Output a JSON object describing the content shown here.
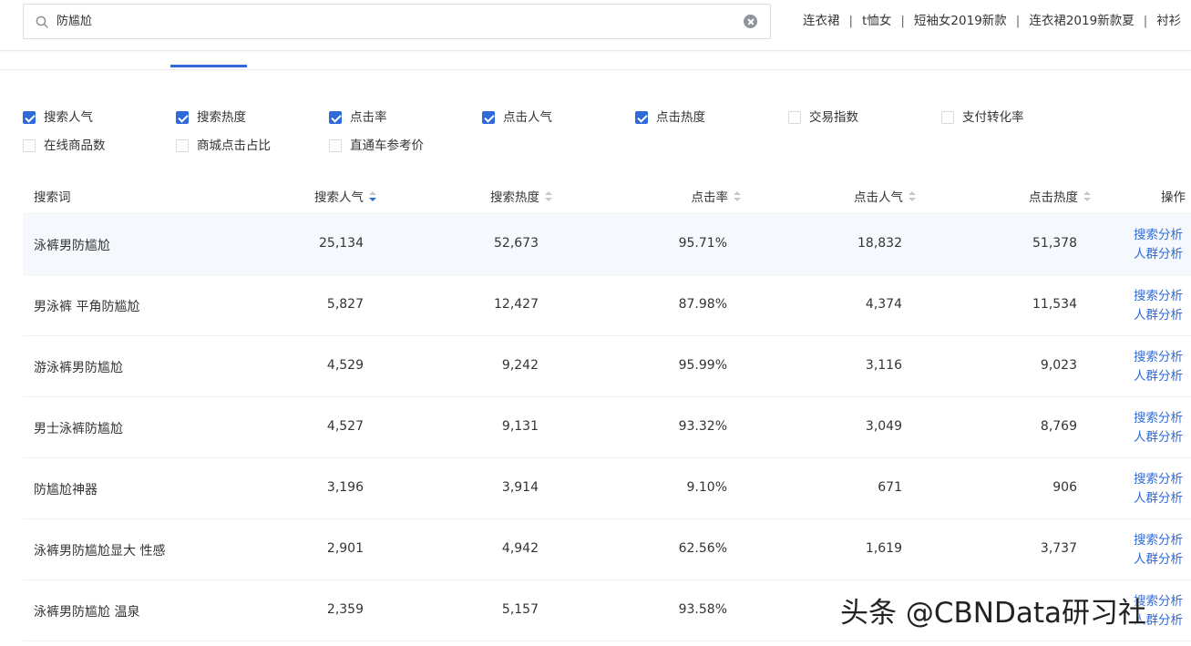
{
  "search": {
    "value": "防尴尬",
    "hot_words": [
      "连衣裙",
      "t恤女",
      "短袖女2019新款",
      "连衣裙2019新款夏",
      "衬衫"
    ],
    "separator": "|"
  },
  "filters": {
    "items": [
      {
        "label": "搜索人气",
        "checked": true
      },
      {
        "label": "搜索热度",
        "checked": true
      },
      {
        "label": "点击率",
        "checked": true
      },
      {
        "label": "点击人气",
        "checked": true
      },
      {
        "label": "点击热度",
        "checked": true
      },
      {
        "label": "交易指数",
        "checked": false
      },
      {
        "label": "支付转化率",
        "checked": false
      },
      {
        "label": "在线商品数",
        "checked": false
      },
      {
        "label": "商城点击占比",
        "checked": false
      },
      {
        "label": "直通车参考价",
        "checked": false
      }
    ]
  },
  "table": {
    "headers": {
      "keyword": "搜索词",
      "search_pop": "搜索人气",
      "search_heat": "搜索热度",
      "ctr": "点击率",
      "click_pop": "点击人气",
      "click_heat": "点击热度",
      "ops": "操作"
    },
    "op_search": "搜索分析",
    "op_crowd": "人群分析",
    "rows": [
      {
        "keyword": "泳裤男防尴尬",
        "search_pop": "25,134",
        "search_heat": "52,673",
        "ctr": "95.71%",
        "click_pop": "18,832",
        "click_heat": "51,378"
      },
      {
        "keyword": "男泳裤 平角防尴尬",
        "search_pop": "5,827",
        "search_heat": "12,427",
        "ctr": "87.98%",
        "click_pop": "4,374",
        "click_heat": "11,534"
      },
      {
        "keyword": "游泳裤男防尴尬",
        "search_pop": "4,529",
        "search_heat": "9,242",
        "ctr": "95.99%",
        "click_pop": "3,116",
        "click_heat": "9,023"
      },
      {
        "keyword": "男士泳裤防尴尬",
        "search_pop": "4,527",
        "search_heat": "9,131",
        "ctr": "93.32%",
        "click_pop": "3,049",
        "click_heat": "8,769"
      },
      {
        "keyword": "防尴尬神器",
        "search_pop": "3,196",
        "search_heat": "3,914",
        "ctr": "9.10%",
        "click_pop": "671",
        "click_heat": "906"
      },
      {
        "keyword": "泳裤男防尴尬显大 性感",
        "search_pop": "2,901",
        "search_heat": "4,942",
        "ctr": "62.56%",
        "click_pop": "1,619",
        "click_heat": "3,737"
      },
      {
        "keyword": "泳裤男防尴尬 温泉",
        "search_pop": "2,359",
        "search_heat": "5,157",
        "ctr": "93.58%",
        "click_pop": "",
        "click_heat": ""
      }
    ]
  },
  "watermark": "头条 @CBNData研习社",
  "colors": {
    "accent": "#2f6bd8",
    "highlight_row": "#f5f9fe"
  }
}
